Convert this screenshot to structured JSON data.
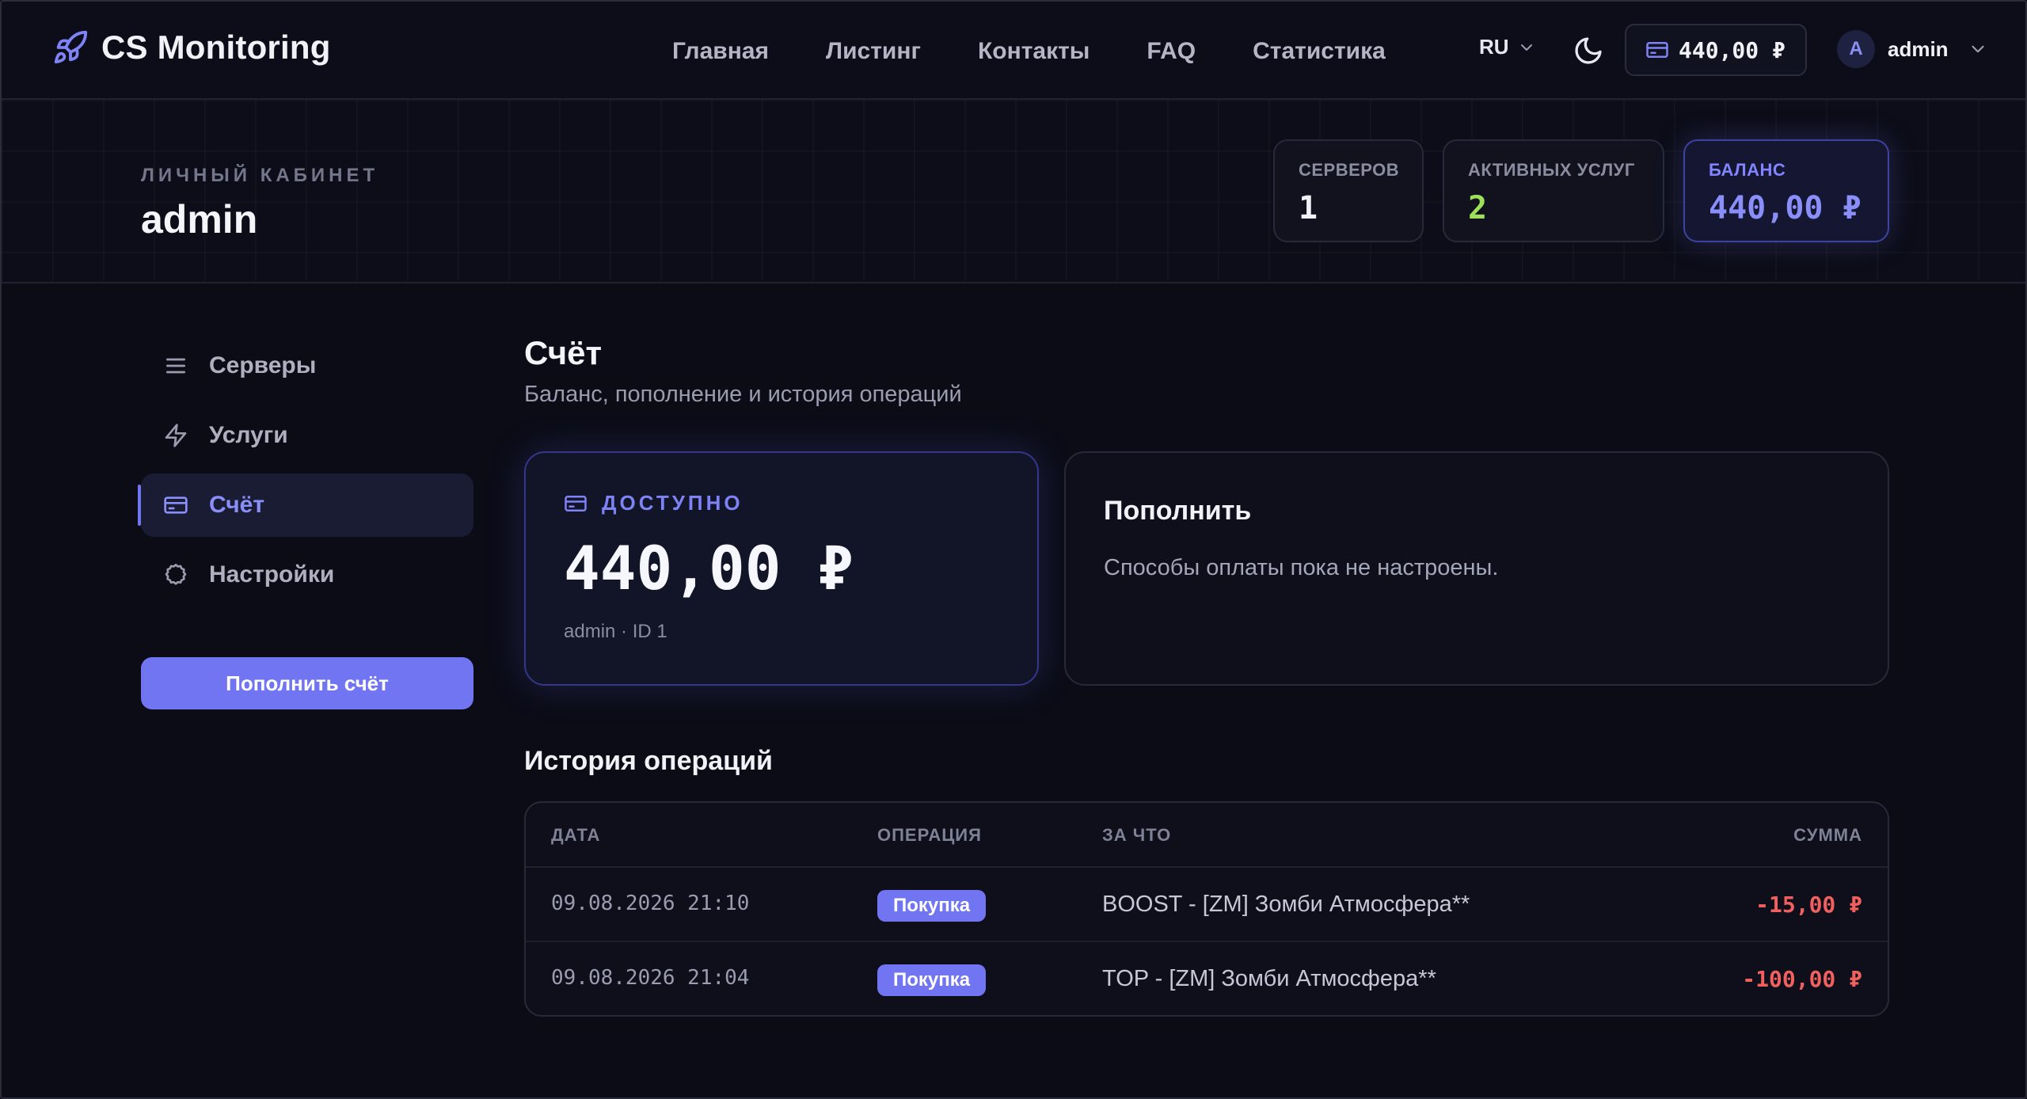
{
  "navbar": {
    "brand": "CS Monitoring",
    "links": [
      "Главная",
      "Листинг",
      "Контакты",
      "FAQ",
      "Статистика"
    ],
    "language": "RU",
    "balance": "440,00 ₽",
    "user": {
      "avatar_letter": "A",
      "name": "admin"
    }
  },
  "header": {
    "label": "ЛИЧНЫЙ КАБИНЕТ",
    "username": "admin",
    "stats": [
      {
        "label": "СЕРВЕРОВ",
        "value": "1"
      },
      {
        "label": "АКТИВНЫХ УСЛУГ",
        "value": "2"
      },
      {
        "label": "БАЛАНС",
        "value": "440,00 ₽"
      }
    ]
  },
  "sidebar": {
    "items": [
      {
        "label": "Серверы",
        "icon": "list-icon"
      },
      {
        "label": "Услуги",
        "icon": "bolt-icon"
      },
      {
        "label": "Счёт",
        "icon": "card-icon",
        "active": true
      },
      {
        "label": "Настройки",
        "icon": "gear-icon"
      }
    ],
    "topup_button": "Пополнить счёт"
  },
  "main": {
    "title": "Счёт",
    "subtitle": "Баланс, пополнение и история операций",
    "available": {
      "label": "ДОСТУПНО",
      "amount": "440,00 ₽",
      "meta": "admin · ID 1"
    },
    "topup": {
      "title": "Пополнить",
      "text": "Способы оплаты пока не настроены."
    },
    "history": {
      "title": "История операций",
      "columns": [
        "ДАТА",
        "ОПЕРАЦИЯ",
        "ЗА ЧТО",
        "СУММА"
      ],
      "rows": [
        {
          "date": "09.08.2026 21:10",
          "operation": "Покупка",
          "description": "BOOST - [ZM] Зомби Атмосфера**",
          "amount": "-15,00 ₽"
        },
        {
          "date": "09.08.2026 21:04",
          "operation": "Покупка",
          "description": "TOP - [ZM] Зомби Атмосфера**",
          "amount": "-100,00 ₽"
        }
      ]
    }
  },
  "colors": {
    "accent": "#7175f2",
    "background": "#0b0c16",
    "positive": "#9ee05a",
    "negative": "#f0605e"
  }
}
